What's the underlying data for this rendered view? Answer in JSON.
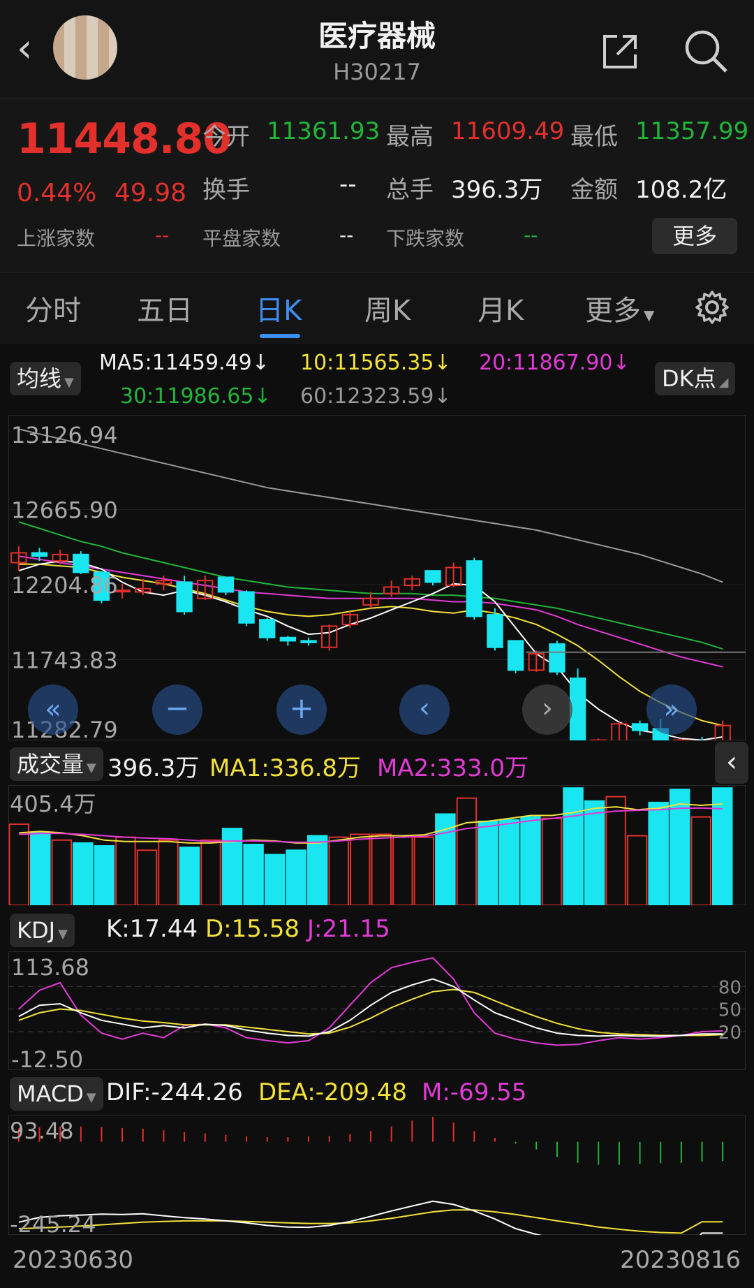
{
  "header": {
    "title": "医疗器械",
    "code": "H30217"
  },
  "quote": {
    "price": "11448.80",
    "change_pct": "0.44%",
    "change": "49.98",
    "open_label": "今开",
    "open": "11361.93",
    "high_label": "最高",
    "high": "11609.49",
    "low_label": "最低",
    "low": "11357.99",
    "turnover_label": "换手",
    "turnover": "--",
    "volume_label": "总手",
    "volume": "396.3万",
    "amount_label": "金额",
    "amount": "108.2亿",
    "up_label": "上涨家数",
    "up": "--",
    "flat_label": "平盘家数",
    "flat": "--",
    "down_label": "下跌家数",
    "down": "--",
    "more": "更多"
  },
  "tabs": [
    "分时",
    "五日",
    "日K",
    "周K",
    "月K",
    "更多"
  ],
  "active_tab": 2,
  "ma_legend": {
    "chip": "均线",
    "ma5": "MA5:11459.49↓",
    "ma10": "10:11565.35↓",
    "ma20": "20:11867.90↓",
    "ma30": "30:11986.65↓",
    "ma60": "60:12323.59↓",
    "dk": "DK点"
  },
  "vol_legend": {
    "chip": "成交量",
    "v": "396.3万",
    "ma1": "MA1:336.8万",
    "ma2": "MA2:333.0万"
  },
  "kdj_legend": {
    "chip": "KDJ",
    "k": "K:17.44",
    "d": "D:15.58",
    "j": "J:21.15"
  },
  "macd_legend": {
    "chip": "MACD",
    "dif": "DIF:-244.26",
    "dea": "DEA:-209.48",
    "m": "M:-69.55"
  },
  "dates": {
    "start": "20230630",
    "end": "20230816"
  },
  "colors": {
    "up": "#e2302c",
    "down": "#19e6f0",
    "ma5": "#ffffff",
    "ma10": "#f3e23c",
    "ma20": "#e23bd6",
    "ma30": "#22b53a",
    "ma60": "#9a9a9a",
    "accent": "#3d8ef0"
  },
  "chart_data": [
    {
      "type": "candlestick",
      "yticks": [
        "13126.94",
        "12665.90",
        "12204.86",
        "11743.83",
        "11282.79"
      ],
      "ylim": [
        11282.79,
        13126.94
      ],
      "candles": [
        [
          12340,
          12400,
          12290,
          12440
        ],
        [
          12400,
          12380,
          12350,
          12430
        ],
        [
          12350,
          12390,
          12330,
          12420
        ],
        [
          12390,
          12280,
          12270,
          12410
        ],
        [
          12280,
          12110,
          12090,
          12290
        ],
        [
          12170,
          12170,
          12120,
          12210
        ],
        [
          12160,
          12180,
          12140,
          12240
        ],
        [
          12210,
          12230,
          12170,
          12260
        ],
        [
          12220,
          12040,
          12020,
          12260
        ],
        [
          12120,
          12230,
          12110,
          12260
        ],
        [
          12250,
          12160,
          12140,
          12250
        ],
        [
          12160,
          11970,
          11950,
          12170
        ],
        [
          11990,
          11880,
          11860,
          12000
        ],
        [
          11880,
          11860,
          11830,
          11890
        ],
        [
          11860,
          11850,
          11830,
          11880
        ],
        [
          11820,
          11950,
          11800,
          11960
        ],
        [
          11960,
          12020,
          11940,
          12040
        ],
        [
          12080,
          12120,
          12060,
          12160
        ],
        [
          12150,
          12190,
          12130,
          12230
        ],
        [
          12200,
          12240,
          12170,
          12260
        ],
        [
          12290,
          12220,
          12200,
          12290
        ],
        [
          12200,
          12310,
          12190,
          12340
        ],
        [
          12350,
          12010,
          11990,
          12370
        ],
        [
          12020,
          11820,
          11800,
          12060
        ],
        [
          11860,
          11680,
          11660,
          11860
        ],
        [
          11680,
          11780,
          11670,
          11800
        ],
        [
          11840,
          11670,
          11650,
          11860
        ],
        [
          11630,
          11120,
          11100,
          11690
        ],
        [
          11160,
          11250,
          11130,
          11260
        ],
        [
          11240,
          11350,
          11220,
          11360
        ],
        [
          11350,
          11310,
          11280,
          11370
        ],
        [
          11320,
          11160,
          11120,
          11380
        ],
        [
          11140,
          11250,
          11080,
          11260
        ],
        [
          11240,
          11230,
          11110,
          11270
        ],
        [
          11220,
          11340,
          11210,
          11370
        ]
      ],
      "ma": {
        "ma5": [
          12290,
          12330,
          12350,
          12340,
          12300,
          12220,
          12160,
          12140,
          12170,
          12140,
          12100,
          12050,
          12010,
          11950,
          11900,
          11910,
          11960,
          12000,
          12050,
          12100,
          12150,
          12210,
          12200,
          12100,
          11940,
          11780,
          11700,
          11540,
          11440,
          11360,
          11310,
          11290,
          11260,
          11250,
          11270
        ],
        "ma10": [
          12330,
          12330,
          12320,
          12310,
          12280,
          12250,
          12230,
          12210,
          12180,
          12150,
          12110,
          12070,
          12040,
          12020,
          12010,
          12020,
          12040,
          12060,
          12070,
          12060,
          12040,
          12030,
          12050,
          12030,
          12000,
          11960,
          11900,
          11830,
          11740,
          11640,
          11550,
          11480,
          11420,
          11370,
          11340
        ],
        "ma20": [
          12380,
          12360,
          12340,
          12320,
          12300,
          12280,
          12260,
          12240,
          12220,
          12200,
          12180,
          12160,
          12150,
          12140,
          12130,
          12120,
          12120,
          12120,
          12120,
          12120,
          12110,
          12100,
          12100,
          12090,
          12070,
          12050,
          12010,
          11960,
          11920,
          11880,
          11840,
          11800,
          11760,
          11730,
          11700
        ],
        "ma30": [
          12590,
          12550,
          12510,
          12470,
          12440,
          12400,
          12370,
          12340,
          12310,
          12280,
          12250,
          12230,
          12210,
          12190,
          12180,
          12170,
          12160,
          12150,
          12150,
          12150,
          12140,
          12140,
          12130,
          12120,
          12100,
          12080,
          12060,
          12030,
          12000,
          11970,
          11940,
          11910,
          11880,
          11850,
          11810
        ],
        "ma60": [
          13160,
          13130,
          13100,
          13070,
          13040,
          13010,
          12980,
          12950,
          12920,
          12890,
          12860,
          12830,
          12800,
          12780,
          12760,
          12740,
          12720,
          12700,
          12680,
          12660,
          12640,
          12620,
          12600,
          12580,
          12560,
          12540,
          12510,
          12480,
          12450,
          12420,
          12390,
          12350,
          12310,
          12270,
          12220
        ]
      }
    },
    {
      "type": "bar",
      "name": "成交量",
      "ytick": "405.4万",
      "ymax": 405.4,
      "values": [
        280,
        250,
        225,
        215,
        205,
        235,
        190,
        225,
        200,
        225,
        265,
        210,
        175,
        190,
        240,
        235,
        245,
        245,
        240,
        235,
        315,
        370,
        290,
        295,
        305,
        300,
        405,
        360,
        375,
        240,
        355,
        400,
        305,
        405
      ],
      "ma1": [
        250,
        255,
        250,
        240,
        225,
        220,
        220,
        220,
        215,
        215,
        220,
        225,
        222,
        215,
        215,
        225,
        235,
        240,
        240,
        243,
        262,
        285,
        290,
        300,
        310,
        310,
        320,
        335,
        340,
        330,
        335,
        350,
        345,
        350
      ],
      "ma2": [
        245,
        248,
        248,
        245,
        240,
        235,
        232,
        230,
        225,
        220,
        222,
        222,
        220,
        218,
        218,
        222,
        228,
        232,
        235,
        238,
        250,
        265,
        272,
        282,
        292,
        300,
        308,
        318,
        325,
        328,
        330,
        335,
        336,
        333
      ]
    },
    {
      "type": "line",
      "name": "KDJ",
      "yticks": [
        "113.68",
        "-12.50"
      ],
      "right_ticks": [
        "80",
        "50",
        "20"
      ],
      "ylim": [
        -12.5,
        113.68
      ],
      "K": [
        40,
        55,
        57,
        45,
        35,
        30,
        25,
        28,
        25,
        30,
        28,
        22,
        18,
        15,
        14,
        20,
        35,
        55,
        72,
        82,
        90,
        80,
        62,
        45,
        35,
        25,
        18,
        15,
        14,
        15,
        14,
        14,
        15,
        17,
        17
      ],
      "D": [
        35,
        45,
        50,
        48,
        43,
        38,
        34,
        32,
        29,
        29,
        29,
        26,
        23,
        20,
        17,
        18,
        26,
        38,
        52,
        63,
        73,
        76,
        72,
        61,
        50,
        40,
        31,
        24,
        19,
        17,
        16,
        15,
        15,
        15,
        16
      ],
      "J": [
        50,
        75,
        85,
        42,
        18,
        10,
        18,
        12,
        28,
        30,
        25,
        12,
        8,
        5,
        8,
        25,
        55,
        85,
        105,
        112,
        118,
        90,
        45,
        18,
        10,
        5,
        2,
        3,
        8,
        12,
        10,
        12,
        15,
        20,
        21
      ]
    },
    {
      "type": "line",
      "name": "MACD",
      "yticks": [
        "93.48",
        "-245.24"
      ],
      "ylim": [
        -245.24,
        93.48
      ],
      "DIF": [
        -210,
        -195,
        -190,
        -188,
        -185,
        -186,
        -184,
        -190,
        -196,
        -200,
        -206,
        -212,
        -220,
        -225,
        -226,
        -220,
        -208,
        -192,
        -175,
        -160,
        -145,
        -155,
        -175,
        -200,
        -230,
        -248,
        -262,
        -275,
        -288,
        -300,
        -310,
        -315,
        -318,
        -244,
        -244
      ],
      "DEA": [
        -230,
        -228,
        -225,
        -222,
        -218,
        -214,
        -210,
        -208,
        -206,
        -206,
        -206,
        -208,
        -210,
        -212,
        -214,
        -214,
        -212,
        -206,
        -198,
        -188,
        -178,
        -172,
        -172,
        -178,
        -186,
        -196,
        -206,
        -215,
        -225,
        -232,
        -238,
        -242,
        -244,
        -209,
        -209
      ],
      "M": [
        35,
        38,
        40,
        40,
        38,
        36,
        34,
        30,
        25,
        22,
        18,
        14,
        12,
        12,
        14,
        15,
        20,
        28,
        40,
        55,
        65,
        50,
        28,
        10,
        -5,
        -20,
        -40,
        -55,
        -60,
        -60,
        -58,
        -56,
        -55,
        -52,
        -50
      ]
    }
  ]
}
